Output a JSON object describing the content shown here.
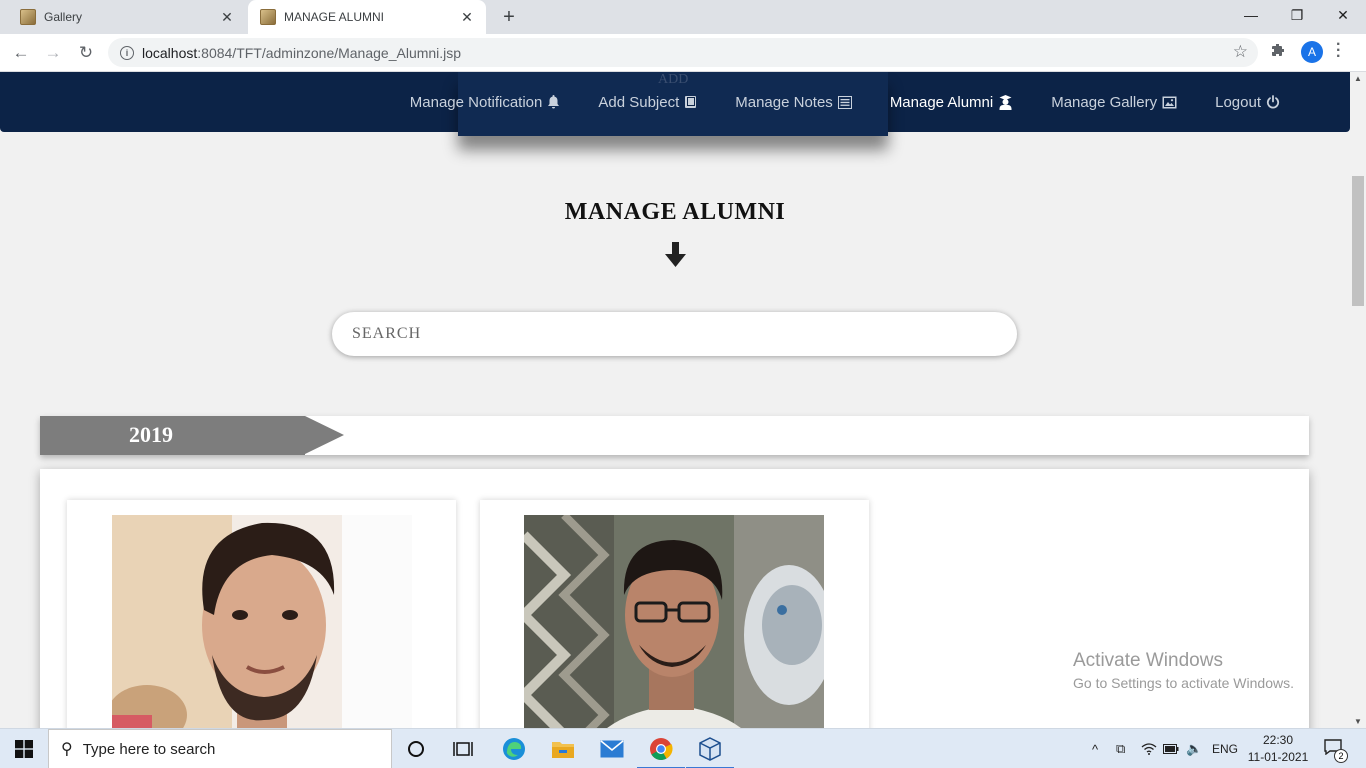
{
  "browser": {
    "tabs": [
      {
        "title": "Gallery",
        "active": false
      },
      {
        "title": "MANAGE ALUMNI",
        "active": true
      }
    ],
    "url_host": "localhost",
    "url_rest": ":8084/TFT/adminzone/Manage_Alumni.jsp",
    "profile_initial": "A"
  },
  "navbar": {
    "ghost_text": "ADD",
    "links": [
      {
        "label": "Manage Notification",
        "icon": "bell-icon"
      },
      {
        "label": "Add Subject",
        "icon": "book-icon"
      },
      {
        "label": "Manage Notes",
        "icon": "list-icon"
      },
      {
        "label": "Manage Alumni",
        "icon": "graduate-icon",
        "current": true
      },
      {
        "label": "Manage Gallery",
        "icon": "image-icon"
      },
      {
        "label": "Logout",
        "icon": "power-icon"
      }
    ]
  },
  "main": {
    "title": "MANAGE ALUMNI",
    "search_placeholder": "SEARCH",
    "year": "2019"
  },
  "watermark": {
    "title": "Activate Windows",
    "subtitle": "Go to Settings to activate Windows."
  },
  "taskbar": {
    "search_placeholder": "Type here to search",
    "language": "ENG",
    "time": "22:30",
    "date": "11-01-2021",
    "notification_count": "2"
  },
  "colors": {
    "navbar_bg": "#0c2347",
    "year_ribbon": "#7d7d7d",
    "page_bg": "#f1f1f1"
  }
}
